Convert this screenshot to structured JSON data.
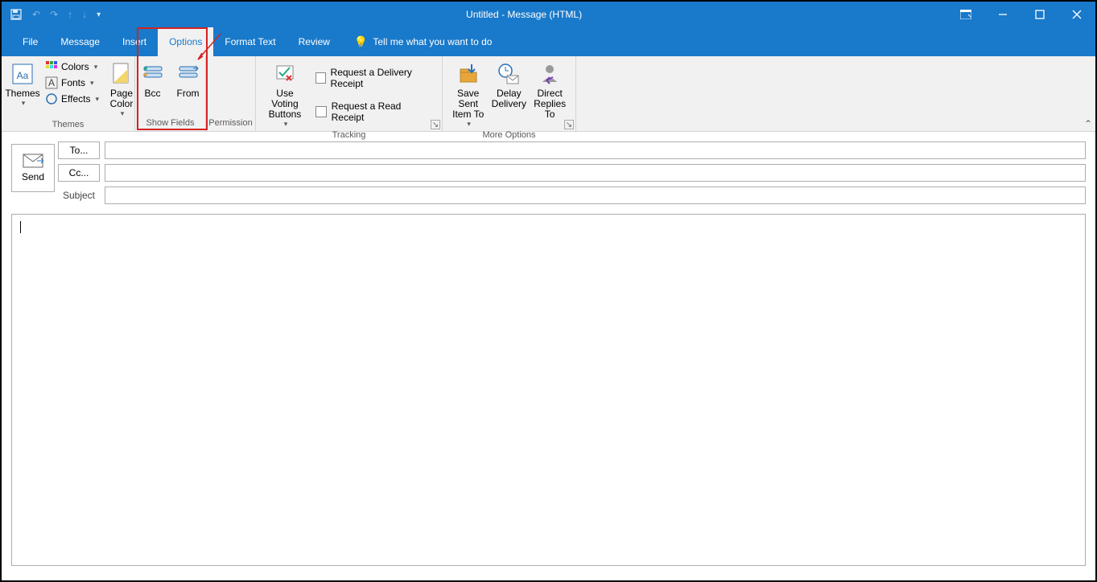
{
  "window": {
    "title": "Untitled - Message (HTML)"
  },
  "tabs": {
    "file": "File",
    "message": "Message",
    "insert": "Insert",
    "options": "Options",
    "format": "Format Text",
    "review": "Review",
    "tellme": "Tell me what you want to do"
  },
  "ribbon": {
    "themes": {
      "label": "Themes",
      "themes_btn": "Themes",
      "colors": "Colors",
      "fonts": "Fonts",
      "effects": "Effects",
      "page_color": "Page\nColor"
    },
    "show_fields": {
      "label": "Show Fields",
      "bcc": "Bcc",
      "from": "From"
    },
    "permission": {
      "label": "Permission"
    },
    "tracking": {
      "label": "Tracking",
      "voting": "Use Voting\nButtons",
      "delivery": "Request a Delivery Receipt",
      "read": "Request a Read Receipt"
    },
    "more": {
      "label": "More Options",
      "save_sent": "Save Sent\nItem To",
      "delay": "Delay\nDelivery",
      "direct": "Direct\nReplies To"
    }
  },
  "compose": {
    "send": "Send",
    "to": "To...",
    "cc": "Cc...",
    "subject": "Subject"
  }
}
